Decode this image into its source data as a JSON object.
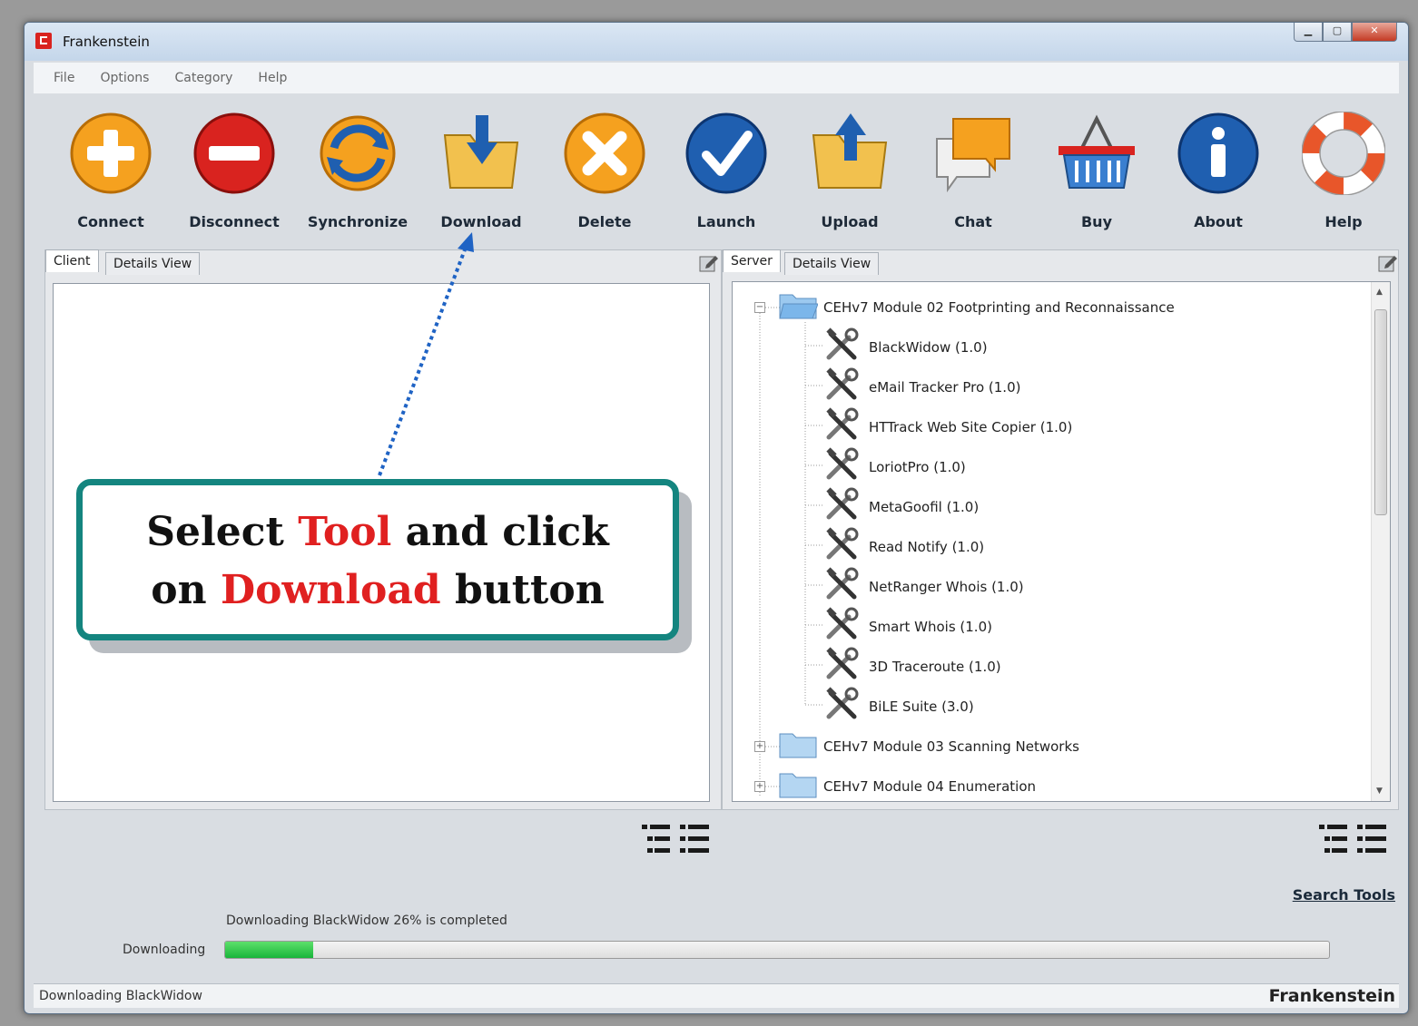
{
  "window": {
    "title": "Frankenstein"
  },
  "menu": [
    "File",
    "Options",
    "Category",
    "Help"
  ],
  "toolbar": [
    {
      "label": "Connect",
      "icon": "plus-icon",
      "color": "#f5a11f"
    },
    {
      "label": "Disconnect",
      "icon": "minus-icon",
      "color": "#d9231f"
    },
    {
      "label": "Synchronize",
      "icon": "sync-icon",
      "color": "#f5a11f"
    },
    {
      "label": "Download",
      "icon": "download-folder-icon",
      "color": "#f2c14e"
    },
    {
      "label": "Delete",
      "icon": "delete-icon",
      "color": "#f5a11f"
    },
    {
      "label": "Launch",
      "icon": "checkmark-icon",
      "color": "#1f5fb0"
    },
    {
      "label": "Upload",
      "icon": "upload-folder-icon",
      "color": "#f2c14e"
    },
    {
      "label": "Chat",
      "icon": "chat-icon",
      "color": "#f5a11f"
    },
    {
      "label": "Buy",
      "icon": "basket-icon",
      "color": "#3a7fd0"
    },
    {
      "label": "About",
      "icon": "info-icon",
      "color": "#1f5fb0"
    },
    {
      "label": "Help",
      "icon": "lifebuoy-icon",
      "color": "#e8562a"
    }
  ],
  "client_pane": {
    "tabs": [
      "Client",
      "Details View"
    ]
  },
  "server_pane": {
    "tabs": [
      "Server",
      "Details View"
    ],
    "tree": [
      {
        "label": "CEHv7 Module 02 Footprinting and Reconnaissance",
        "expanded": true,
        "children": [
          "BlackWidow (1.0)",
          "eMail Tracker Pro (1.0)",
          "HTTrack Web Site Copier (1.0)",
          "LoriotPro (1.0)",
          "MetaGoofil (1.0)",
          "Read Notify (1.0)",
          "NetRanger Whois (1.0)",
          "Smart Whois (1.0)",
          "3D Traceroute (1.0)",
          "BiLE Suite (3.0)"
        ]
      },
      {
        "label": "CEHv7 Module 03 Scanning Networks",
        "expanded": false
      },
      {
        "label": "CEHv7 Module 04 Enumeration",
        "expanded": false
      }
    ]
  },
  "callout": {
    "part1": "Select ",
    "hl1": "Tool",
    "part2": " and click",
    "part3": "on ",
    "hl2": "Download",
    "part4": " button"
  },
  "search_tools": "Search Tools",
  "progress": {
    "message": "Downloading BlackWidow 26% is completed",
    "label": "Downloading",
    "fraction": 0.08
  },
  "statusbar": {
    "text": "Downloading BlackWidow",
    "brand": "Frankenstein"
  }
}
